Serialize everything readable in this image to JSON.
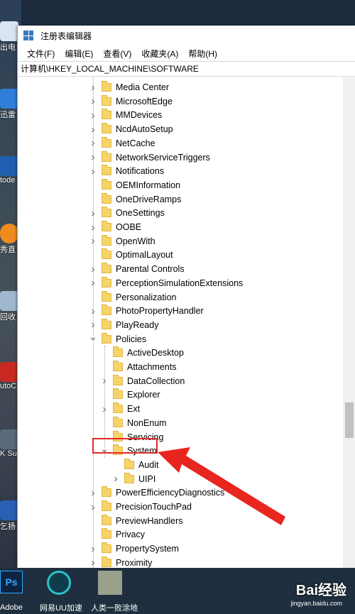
{
  "window": {
    "title": "注册表编辑器",
    "menu": [
      "文件(F)",
      "编辑(E)",
      "查看(V)",
      "收藏夹(A)",
      "帮助(H)"
    ],
    "address": "计算机\\HKEY_LOCAL_MACHINE\\SOFTWARE"
  },
  "tree": [
    {
      "label": "Media Center",
      "level": 0,
      "expander": "collapsed"
    },
    {
      "label": "MicrosoftEdge",
      "level": 0,
      "expander": "collapsed"
    },
    {
      "label": "MMDevices",
      "level": 0,
      "expander": "collapsed"
    },
    {
      "label": "NcdAutoSetup",
      "level": 0,
      "expander": "collapsed"
    },
    {
      "label": "NetCache",
      "level": 0,
      "expander": "collapsed"
    },
    {
      "label": "NetworkServiceTriggers",
      "level": 0,
      "expander": "collapsed"
    },
    {
      "label": "Notifications",
      "level": 0,
      "expander": "collapsed"
    },
    {
      "label": "OEMInformation",
      "level": 0,
      "expander": "none"
    },
    {
      "label": "OneDriveRamps",
      "level": 0,
      "expander": "none"
    },
    {
      "label": "OneSettings",
      "level": 0,
      "expander": "collapsed"
    },
    {
      "label": "OOBE",
      "level": 0,
      "expander": "collapsed"
    },
    {
      "label": "OpenWith",
      "level": 0,
      "expander": "collapsed"
    },
    {
      "label": "OptimalLayout",
      "level": 0,
      "expander": "none"
    },
    {
      "label": "Parental Controls",
      "level": 0,
      "expander": "collapsed"
    },
    {
      "label": "PerceptionSimulationExtensions",
      "level": 0,
      "expander": "collapsed"
    },
    {
      "label": "Personalization",
      "level": 0,
      "expander": "none"
    },
    {
      "label": "PhotoPropertyHandler",
      "level": 0,
      "expander": "collapsed"
    },
    {
      "label": "PlayReady",
      "level": 0,
      "expander": "collapsed"
    },
    {
      "label": "Policies",
      "level": 0,
      "expander": "expanded"
    },
    {
      "label": "ActiveDesktop",
      "level": 1,
      "expander": "none"
    },
    {
      "label": "Attachments",
      "level": 1,
      "expander": "none"
    },
    {
      "label": "DataCollection",
      "level": 1,
      "expander": "collapsed"
    },
    {
      "label": "Explorer",
      "level": 1,
      "expander": "none"
    },
    {
      "label": "Ext",
      "level": 1,
      "expander": "collapsed"
    },
    {
      "label": "NonEnum",
      "level": 1,
      "expander": "none"
    },
    {
      "label": "Servicing",
      "level": 1,
      "expander": "none"
    },
    {
      "label": "System",
      "level": 1,
      "expander": "expanded",
      "selected": true
    },
    {
      "label": "Audit",
      "level": 2,
      "expander": "none"
    },
    {
      "label": "UIPI",
      "level": 2,
      "expander": "collapsed"
    },
    {
      "label": "PowerEfficiencyDiagnostics",
      "level": 0,
      "expander": "collapsed"
    },
    {
      "label": "PrecisionTouchPad",
      "level": 0,
      "expander": "collapsed"
    },
    {
      "label": "PreviewHandlers",
      "level": 0,
      "expander": "none"
    },
    {
      "label": "Privacy",
      "level": 0,
      "expander": "none"
    },
    {
      "label": "PropertySystem",
      "level": 0,
      "expander": "collapsed"
    },
    {
      "label": "Proximity",
      "level": 0,
      "expander": "collapsed"
    }
  ],
  "desktop_icons": [
    {
      "label": "出电",
      "color": "#d9e6f2"
    },
    {
      "label": "迅雷",
      "color": "#2f7fd9"
    },
    {
      "label": "todе",
      "color": "#1f5fb0"
    },
    {
      "label": "秀直",
      "color": "#f08a1c"
    },
    {
      "label": "回收",
      "color": "#9fb8cf"
    },
    {
      "label": "utoC",
      "color": "#c8281f"
    },
    {
      "label": "K Su",
      "color": "#5a6a7a"
    },
    {
      "label": "乞扬",
      "color": "#2a5fb3"
    },
    {
      "label": "Ps",
      "color": "#0d2340"
    }
  ],
  "taskbar": {
    "items": [
      "Adobe",
      "网易UU加速",
      "人类一败涂地"
    ]
  },
  "watermark": {
    "text": "Bai经验",
    "sub": "jingyan.baidu.com"
  },
  "colors": {
    "accent": "#e02a2a",
    "folder": "#f6d46a"
  }
}
